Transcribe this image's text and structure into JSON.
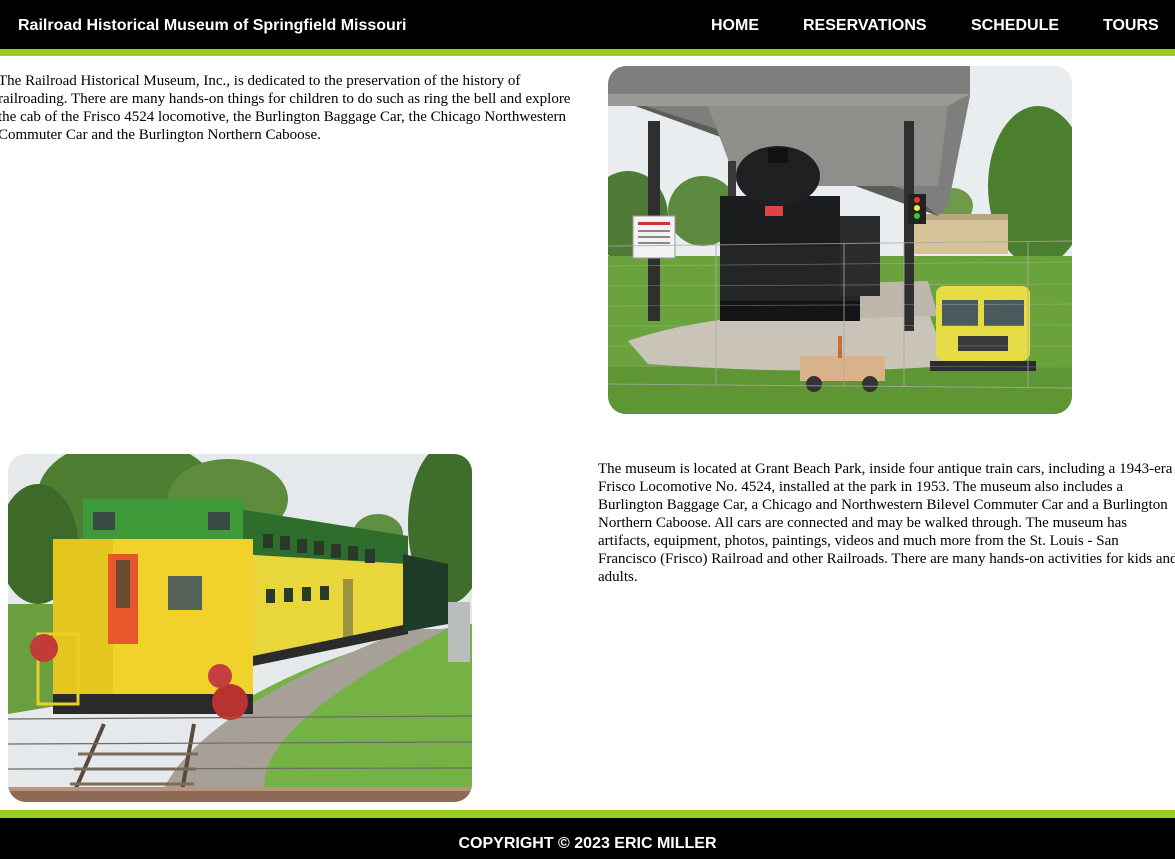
{
  "header": {
    "site_title": "Railroad Historical Museum of Springfield Missouri",
    "nav": [
      {
        "label": "HOME"
      },
      {
        "label": "RESERVATIONS"
      },
      {
        "label": "SCHEDULE"
      },
      {
        "label": "TOURS"
      }
    ]
  },
  "main": {
    "intro_paragraph": "The Railroad Historical Museum, Inc., is dedicated to the preservation of the history of railroading. There are many hands-on things for children to do such as ring the bell and explore the cab of the Frisco 4524 locomotive, the Burlington Baggage Car, the Chicago Northwestern Commuter Car and the Burlington Northern Caboose.",
    "location_paragraph": "The museum is located at Grant Beach Park, inside four antique train cars, including a 1943-era Frisco Locomotive No. 4524, installed at the park in 1953. The museum also includes a Burlington Baggage Car, a Chicago and Northwestern Bilevel Commuter Car and a Burlington Northern Caboose. All cars are connected and may be walked through. The museum has artifacts, equipment, photos, paintings, videos and much more from the St. Louis - San Francisco (Frisco) Railroad and other Railroads. There are many hands-on activities for kids and adults."
  },
  "footer": {
    "copyright": "COPYRIGHT © 2023 ERIC MILLER"
  },
  "colors": {
    "bar_background": "#000000",
    "accent_green": "#9acd1e",
    "page_background": "#ffffff"
  }
}
